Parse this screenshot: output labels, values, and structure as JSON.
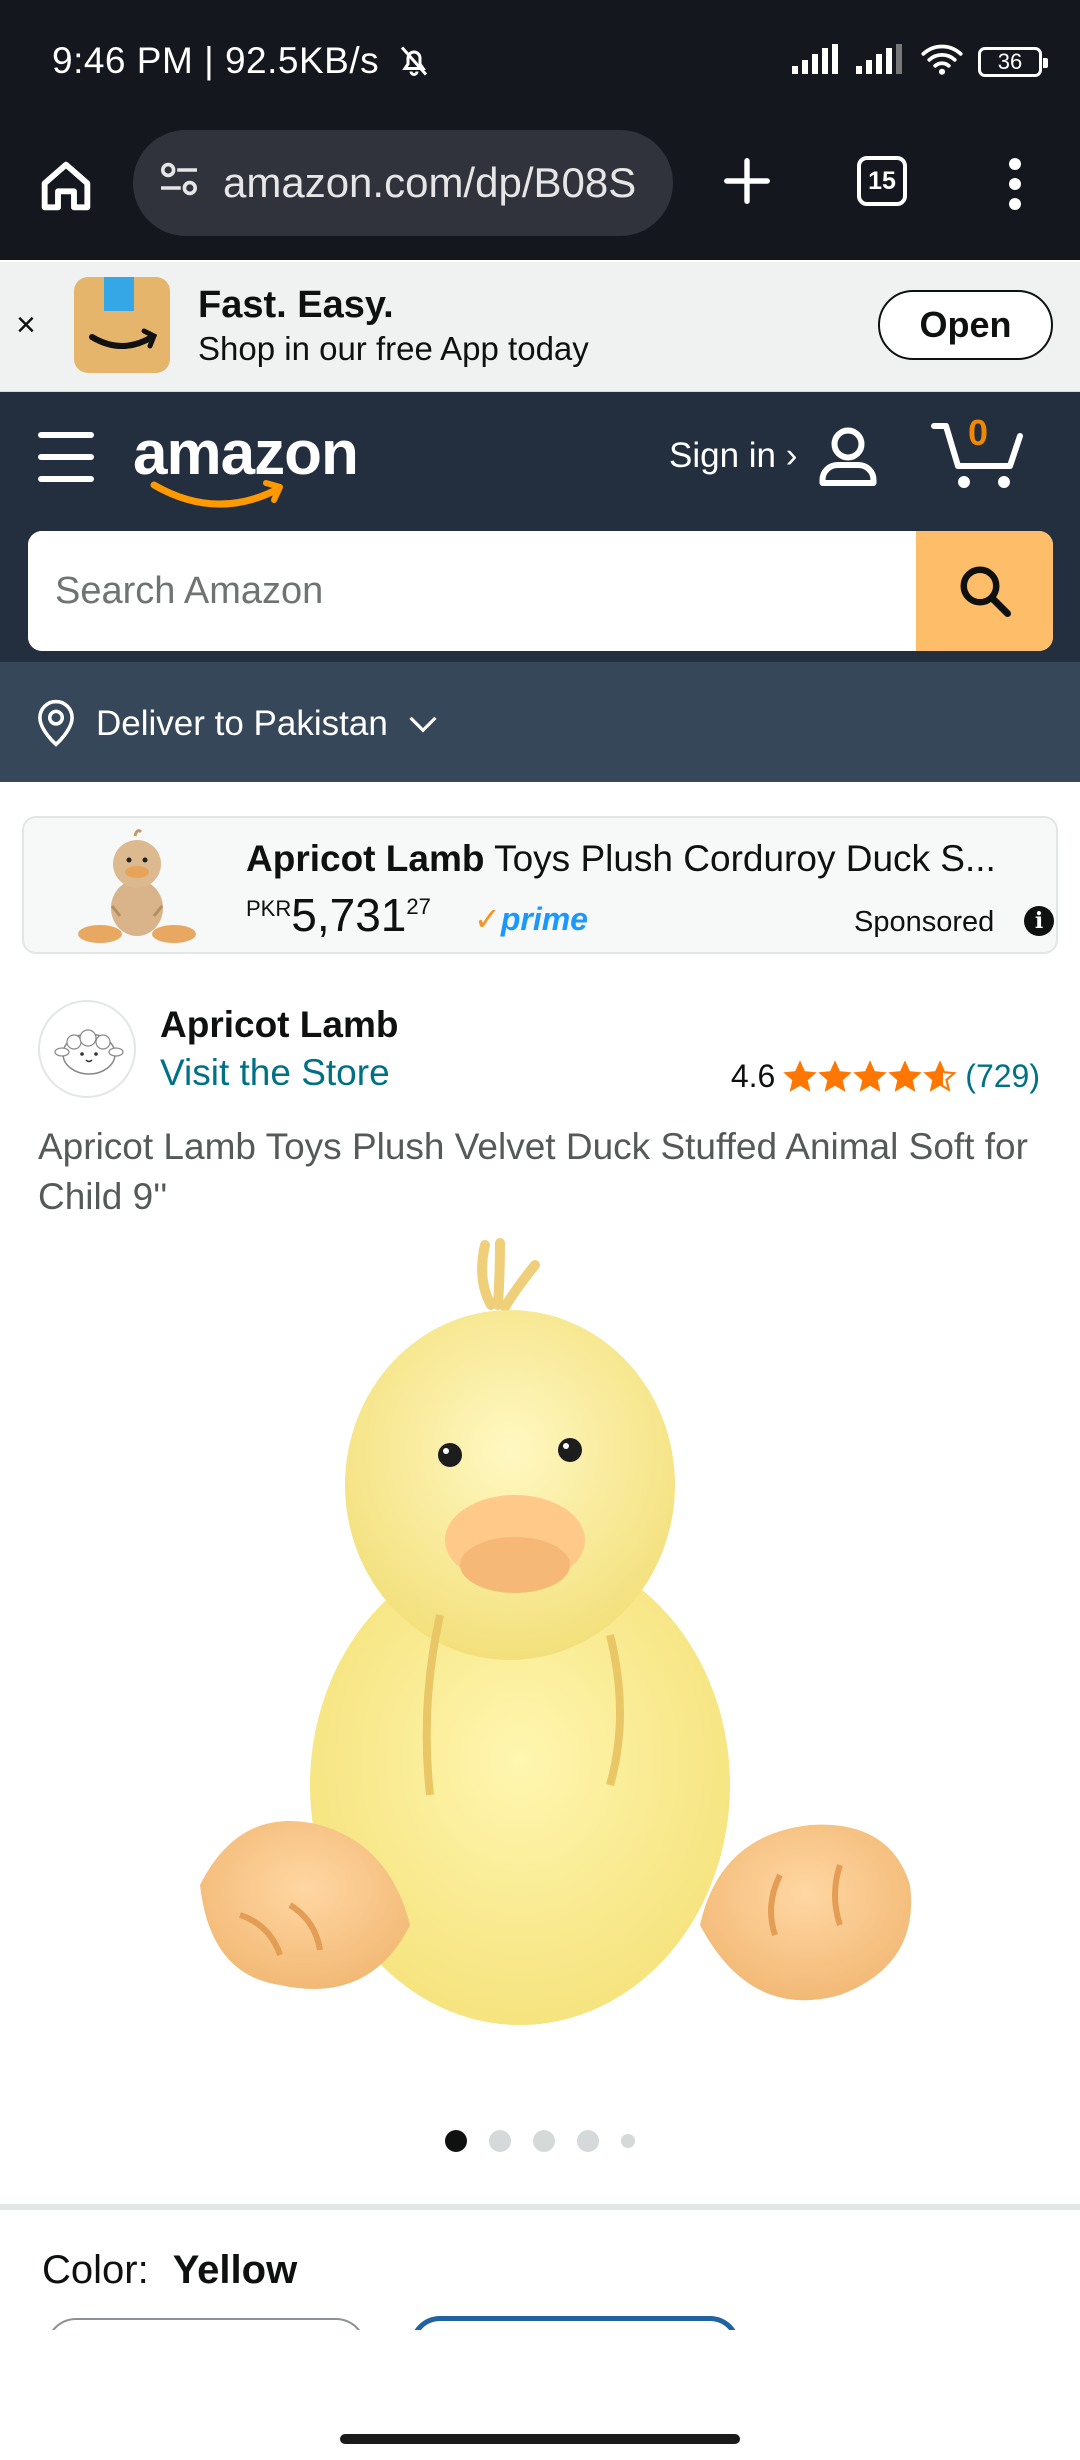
{
  "status_bar": {
    "time": "9:46 PM | 92.5KB/s",
    "battery": "36"
  },
  "browser": {
    "url": "amazon.com/dp/B08S",
    "tab_count": "15"
  },
  "app_banner": {
    "close": "×",
    "title": "Fast. Easy.",
    "subtitle": "Shop in our free App today",
    "open_label": "Open"
  },
  "header": {
    "logo": "amazon",
    "sign_in": "Sign in ›",
    "cart_count": "0",
    "search_placeholder": "Search Amazon"
  },
  "deliver": {
    "text": "Deliver to Pakistan"
  },
  "sponsored": {
    "brand": "Apricot Lamb",
    "title_rest": " Toys Plush Corduroy Duck S...",
    "currency": "PKR",
    "price_whole": "5,731",
    "price_fraction": "27",
    "prime_label": "prime",
    "label": "Sponsored",
    "info": "i"
  },
  "product": {
    "brand": "Apricot Lamb",
    "visit_store": "Visit the Store",
    "rating": "4.6",
    "rating_value": 4.6,
    "rating_count": "(729)",
    "title": "Apricot Lamb Toys Plush Velvet Duck Stuffed Animal Soft for Child 9''",
    "image_count": 5,
    "active_image": 1
  },
  "options": {
    "color_label": "Color:",
    "color_value": "Yellow"
  },
  "colors": {
    "header_bg": "#232f3e",
    "deliver_bg": "#37475a",
    "search_button": "#febd69",
    "link": "#007185",
    "star": "#ff7700"
  }
}
